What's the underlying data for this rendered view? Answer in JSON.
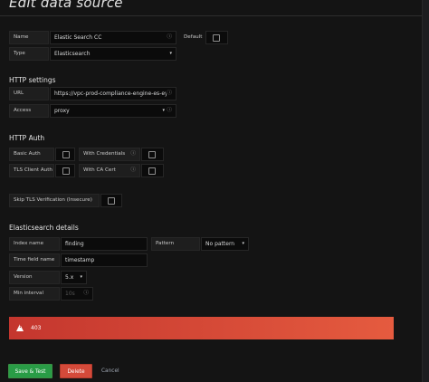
{
  "page": {
    "title": "Edit data source"
  },
  "basic": {
    "name_label": "Name",
    "name_value": "Elastic Search CC",
    "default_label": "Default",
    "type_label": "Type",
    "type_value": "Elasticsearch"
  },
  "http": {
    "heading": "HTTP settings",
    "url_label": "URL",
    "url_value": "https://vpc-prod-compliance-engine-es-eyf...",
    "access_label": "Access",
    "access_value": "proxy"
  },
  "auth": {
    "heading": "HTTP Auth",
    "basic_auth_label": "Basic Auth",
    "with_credentials_label": "With Credentials",
    "tls_client_auth_label": "TLS Client Auth",
    "with_ca_cert_label": "With CA Cert",
    "skip_tls_label": "Skip TLS Verification (Insecure)"
  },
  "es": {
    "heading": "Elasticsearch details",
    "index_name_label": "Index name",
    "index_name_value": "finding",
    "pattern_label": "Pattern",
    "pattern_value": "No pattern",
    "time_field_label": "Time field name",
    "time_field_value": "timestamp",
    "version_label": "Version",
    "version_value": "5.x",
    "min_interval_label": "Min interval",
    "min_interval_placeholder": "10s"
  },
  "alert": {
    "message": "403",
    "color": "#d44a3a"
  },
  "actions": {
    "save_label": "Save & Test",
    "delete_label": "Delete",
    "cancel_label": "Cancel"
  },
  "icons": {
    "info": "ⓘ",
    "caret": "▾",
    "warning": "!"
  }
}
